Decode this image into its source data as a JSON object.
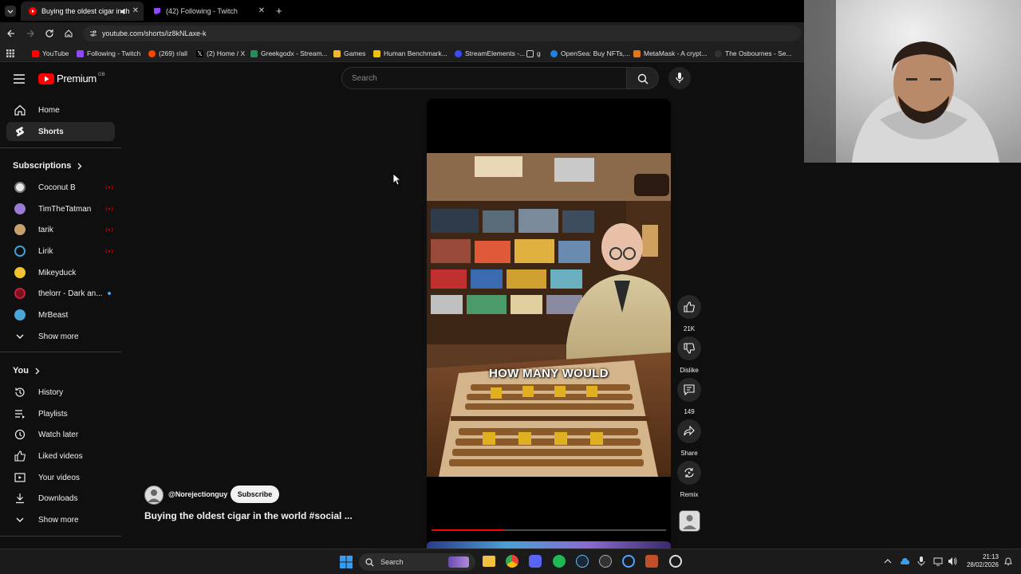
{
  "browser": {
    "tabs": [
      {
        "title": "Buying the oldest cigar in th",
        "active": true
      },
      {
        "title": "(42) Following - Twitch",
        "active": false
      }
    ],
    "url": "youtube.com/shorts/iz8kNLaxe-k",
    "bookmarks": [
      "YouTube",
      "Following - Twitch",
      "(269) r/all",
      "(2) Home / X",
      "Greekgodx - Stream...",
      "Games",
      "Human Benchmark...",
      "StreamElements -...",
      "g",
      "OpenSea: Buy NFTs,...",
      "MetaMask - A crypt...",
      "The Osbournes - Se..."
    ]
  },
  "youtube": {
    "logo_text": "Premium",
    "logo_region": "GB",
    "search_placeholder": "Search",
    "sidebar": {
      "main": [
        {
          "label": "Home",
          "icon": "home-icon"
        },
        {
          "label": "Shorts",
          "icon": "shorts-icon"
        }
      ],
      "subscriptions_title": "Subscriptions",
      "subscriptions": [
        {
          "label": "Coconut B",
          "live": true,
          "color": "#e8e8e8"
        },
        {
          "label": "TimTheTatman",
          "live": true,
          "color": "#9b7bd6"
        },
        {
          "label": "tarik",
          "live": true,
          "color": "#c96"
        },
        {
          "label": "Lirik",
          "live": true,
          "color": "#3fa0d8"
        },
        {
          "label": "Mikeyduck",
          "live": false,
          "color": "#f2c230"
        },
        {
          "label": "thelorr - Dark an...",
          "live": false,
          "dot": true,
          "color": "#c81e3a"
        },
        {
          "label": "MrBeast",
          "live": false,
          "color": "#4aa6d8"
        }
      ],
      "subs_show_more": "Show more",
      "you_title": "You",
      "you": [
        {
          "label": "History",
          "icon": "history-icon"
        },
        {
          "label": "Playlists",
          "icon": "playlists-icon"
        },
        {
          "label": "Watch later",
          "icon": "watch-later-icon"
        },
        {
          "label": "Liked videos",
          "icon": "liked-icon"
        },
        {
          "label": "Your videos",
          "icon": "your-videos-icon"
        },
        {
          "label": "Downloads",
          "icon": "downloads-icon"
        }
      ],
      "you_show_more": "Show more"
    },
    "short": {
      "caption": "HOW MANY WOULD",
      "channel": "@Norejectionguy",
      "subscribe_label": "Subscribe",
      "title": "Buying the oldest cigar in the world #social ...",
      "progress_fraction": 0.31
    },
    "actions": {
      "like_count": "21K",
      "dislike_label": "Dislike",
      "comments_count": "149",
      "share_label": "Share",
      "remix_label": "Remix"
    }
  },
  "taskbar": {
    "search_label": "Search",
    "time": "21:13",
    "date": "28/02/2026"
  },
  "colors": {
    "yt_red": "#ff0000",
    "accent_red": "#cc0000"
  }
}
